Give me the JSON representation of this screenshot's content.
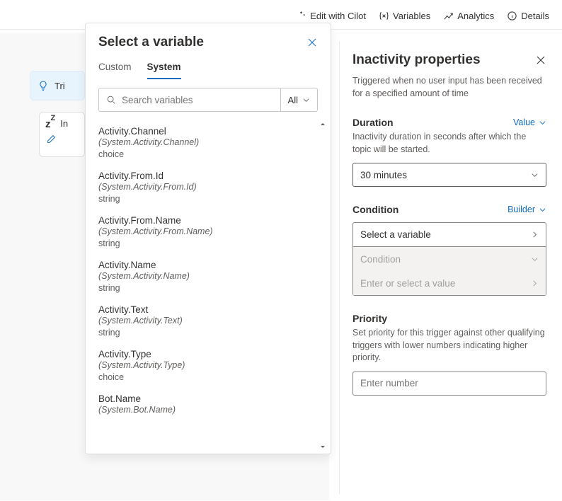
{
  "toolbar": {
    "edit_label_prefix": "Edit with C",
    "edit_label_suffix": "ilot",
    "variables_label": "Variables",
    "analytics_label": "Analytics",
    "details_label": "Details"
  },
  "canvas": {
    "trigger_label": "Tri",
    "inactivity_label": "In"
  },
  "var_panel": {
    "title": "Select a variable",
    "tab_custom": "Custom",
    "tab_system": "System",
    "search_placeholder": "Search variables",
    "filter_label": "All",
    "items": [
      {
        "name": "Activity.Channel",
        "sys": "(System.Activity.Channel)",
        "type": "choice"
      },
      {
        "name": "Activity.From.Id",
        "sys": "(System.Activity.From.Id)",
        "type": "string"
      },
      {
        "name": "Activity.From.Name",
        "sys": "(System.Activity.From.Name)",
        "type": "string"
      },
      {
        "name": "Activity.Name",
        "sys": "(System.Activity.Name)",
        "type": "string"
      },
      {
        "name": "Activity.Text",
        "sys": "(System.Activity.Text)",
        "type": "string"
      },
      {
        "name": "Activity.Type",
        "sys": "(System.Activity.Type)",
        "type": "choice"
      },
      {
        "name": "Bot.Name",
        "sys": "(System.Bot.Name)",
        "type": ""
      }
    ]
  },
  "props": {
    "title": "Inactivity properties",
    "desc": "Triggered when no user input has been received for a specified amount of time",
    "duration": {
      "label": "Duration",
      "mode": "Value",
      "desc": "Inactivity duration in seconds after which the topic will be started.",
      "value": "30 minutes"
    },
    "condition": {
      "label": "Condition",
      "mode": "Builder",
      "select_variable": "Select a variable",
      "condition_placeholder": "Condition",
      "value_placeholder": "Enter or select a value"
    },
    "priority": {
      "label": "Priority",
      "desc": "Set priority for this trigger against other qualifying triggers with lower numbers indicating higher priority.",
      "placeholder": "Enter number"
    }
  }
}
